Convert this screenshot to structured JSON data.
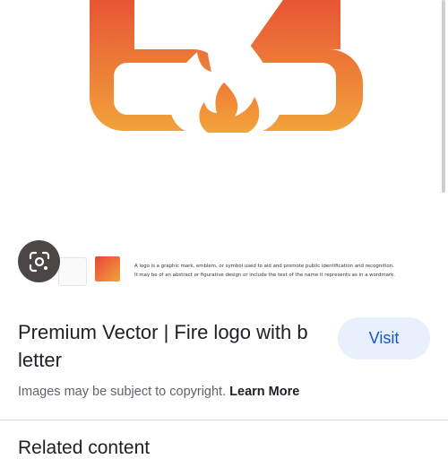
{
  "preview": {
    "caption_line1": "A logo is a graphic mark, emblem, or symbol used to aid and promote public identification and recognition.",
    "caption_line2": "It may be of an abstract or figurative design or include the text of the name it represents as in a wordmark.",
    "colors": {
      "top": "#e64a33",
      "bottom": "#f2a23b"
    }
  },
  "lens_button": {
    "icon": "google-lens-icon"
  },
  "result": {
    "title": "Premium Vector | Fire logo with b letter",
    "visit_label": "Visit",
    "copyright_text": "Images may be subject to copyright.",
    "learn_more_label": "Learn More"
  },
  "related": {
    "heading": "Related content"
  }
}
